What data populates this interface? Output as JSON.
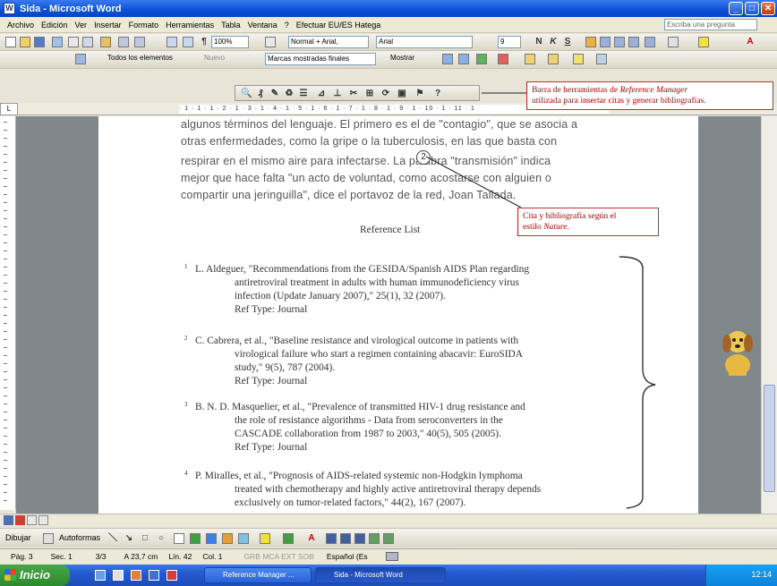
{
  "window": {
    "title": "Sida - Microsoft Word"
  },
  "menubar": {
    "items": [
      "Archivo",
      "Edición",
      "Ver",
      "Insertar",
      "Formato",
      "Herramientas",
      "Tabla",
      "Ventana",
      "?",
      "Efectuar EU/ES Hatega"
    ],
    "ask_placeholder": "Escriba una pregunta"
  },
  "toolbar": {
    "zoom": "100%",
    "style": "Normal + Arial,",
    "font": "Arial",
    "size": "9",
    "review_filter": "Todos los elementos",
    "review_new": "Nuevo",
    "markup": "Marcas mostradas finales",
    "show": "Mostrar"
  },
  "document": {
    "paragraph_lines": [
      "algunos términos del lenguaje. El primero es el de \"contagio\", que se asocia a",
      "otras enfermedades, como la gripe o la tuberculosis, en las que basta con",
      "respirar en el mismo aire para infectarse.  La palabra \"transmisión\" indica",
      "mejor que hace falta \"un acto de voluntad, como acostarse con alguien o",
      "compartir una jeringuilla\", dice el portavoz de la red, Joan Tallada."
    ],
    "citation_marker": "2",
    "reference_title": "Reference List",
    "references": [
      {
        "num": "1",
        "lines": [
          "L. Aldeguer, \"Recommendations from the GESIDA/Spanish AIDS Plan regarding",
          "antiretroviral treatment in adults with human immunodeficiency virus",
          "infection (Update January 2007),\" 25(1), 32 (2007).",
          "Ref Type: Journal"
        ]
      },
      {
        "num": "2",
        "lines": [
          "C. Cabrera, et al., \"Baseline resistance and virological outcome in patients with",
          "virological failure who start a regimen containing abacavir: EuroSIDA",
          "study,\" 9(5), 787 (2004).",
          "Ref Type: Journal"
        ]
      },
      {
        "num": "3",
        "lines": [
          "B. N. D. Masquelier, et al., \"Prevalence of transmitted HIV-1 drug resistance and",
          "the role of resistance algorithms - Data from seroconverters in the",
          "CASCADE collaboration from 1987 to 2003,\" 40(5), 505 (2005).",
          "Ref Type: Journal"
        ]
      },
      {
        "num": "4",
        "lines": [
          "P. Miralles, et al., \"Prognosis of AIDS-related systemic non-Hodgkin lymphoma",
          "treated with chemotherapy and highly active antiretroviral therapy depends",
          "exclusively on tumor-related factors,\" 44(2), 167 (2007)."
        ]
      }
    ]
  },
  "callouts": {
    "toolbar_note": {
      "prefix": "Barra de herramientas de ",
      "emph": "Reference Manager",
      "suffix": "utilizada para insertar citas y generar bibliografías."
    },
    "citation_note": {
      "prefix": "Cita y bibliografía según el",
      "mid": "estilo ",
      "emph": "Nature",
      "end": "."
    }
  },
  "drawbar": {
    "dibujar": "Dibujar",
    "autoformas": "Autoformas"
  },
  "status": {
    "page": "Pág. 3",
    "section": "Sec. 1",
    "count": "3/3",
    "position": "A 23,7 cm",
    "line": "Lín. 42",
    "column": "Col. 1",
    "modes": "GRB  MCA  EXT  SOB",
    "language": "Español (Es"
  },
  "taskbar": {
    "start": "Inicio",
    "tasks": [
      "Reference Manager ...",
      "Sida - Microsoft Word"
    ],
    "clock": "12:14"
  },
  "colors": {
    "title": "#0a50d8",
    "callout": "#c00000"
  }
}
